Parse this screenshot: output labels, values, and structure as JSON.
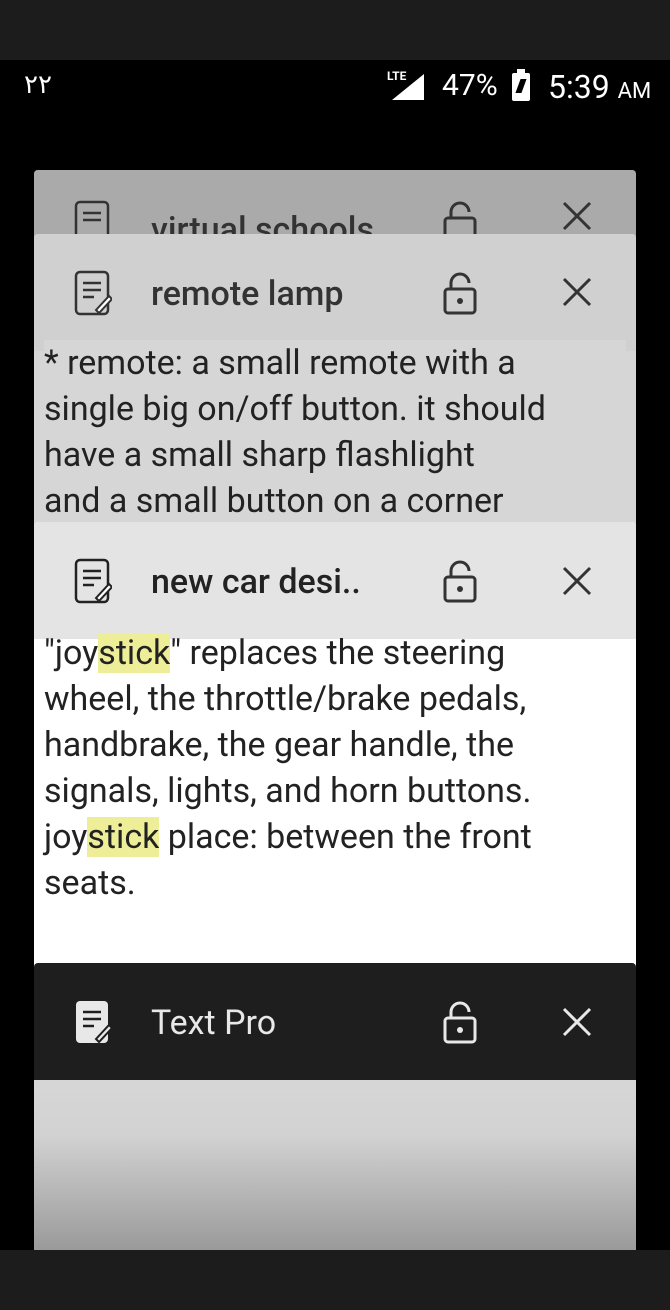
{
  "status_bar": {
    "left_text": "٢٢",
    "network": "LTE",
    "battery": "47%",
    "time": "5:39",
    "ampm": "AM"
  },
  "cards": [
    {
      "title": "virtual schools",
      "body": []
    },
    {
      "title": "remote lamp",
      "body": [
        "* remote: a small remote with a",
        "single big on/off button. it should",
        "have a small sharp flashlight",
        "and a small button on a corner"
      ]
    },
    {
      "title": "new car desi..",
      "body": []
    },
    {
      "title": "Text Pro",
      "body": []
    }
  ],
  "car_body": {
    "l1_a": "\"joy",
    "l1_hl": "stick",
    "l1_b": "\" replaces the steering",
    "l2": "wheel, the throttle/brake pedals,",
    "l3": "handbrake, the gear handle, the",
    "l4": "signals, lights, and horn buttons.",
    "l5_a": "joy",
    "l5_hl": "stick",
    "l5_b": " place: between the front",
    "l6": "seats."
  },
  "icons": {
    "doc": "note-icon",
    "lock": "unlock-icon",
    "close": "close-icon"
  },
  "colors": {
    "highlight": "#eeee99",
    "dark_header": "#1e1e1e"
  }
}
